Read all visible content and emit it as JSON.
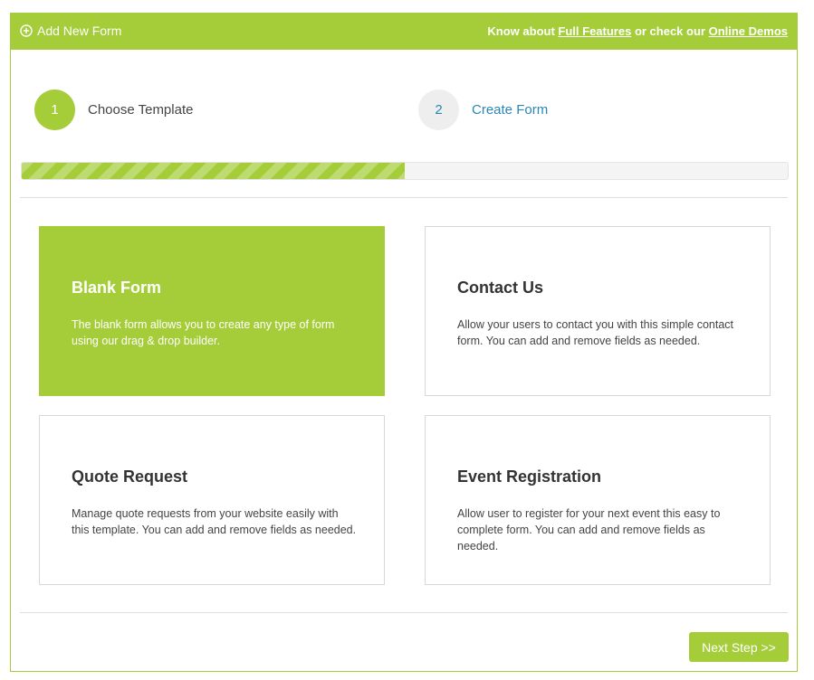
{
  "header": {
    "title": "Add New Form",
    "icon": "plus-circle-icon",
    "know_about": "Know about ",
    "full_features": "Full Features",
    "or_check": " or check our ",
    "online_demos": "Online Demos"
  },
  "steps": [
    {
      "number": "1",
      "label": "Choose Template",
      "state": "active"
    },
    {
      "number": "2",
      "label": "Create Form",
      "state": "inactive"
    }
  ],
  "progress": {
    "percent": 50
  },
  "templates": [
    {
      "title": "Blank Form",
      "description": "The blank form allows you to create any type of form using our drag & drop builder.",
      "selected": true
    },
    {
      "title": "Contact Us",
      "description": "Allow your users to contact you with this simple contact form. You can add and remove fields as needed.",
      "selected": false
    },
    {
      "title": "Quote Request",
      "description": "Manage quote requests from your website easily with this template. You can add and remove fields as needed.",
      "selected": false
    },
    {
      "title": "Event Registration",
      "description": "Allow user to register for your next event this easy to complete form. You can add and remove fields as needed.",
      "selected": false
    }
  ],
  "footer": {
    "next_label": "Next Step >>"
  },
  "colors": {
    "accent": "#a4cd39",
    "link": "#2a86b4",
    "inactive_circle": "#eeeeee"
  }
}
